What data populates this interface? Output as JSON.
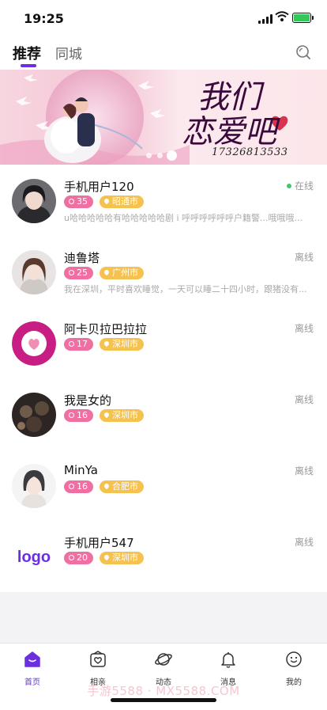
{
  "status_bar": {
    "time": "19:25"
  },
  "header": {
    "tabs": [
      {
        "label": "推荐",
        "active": true
      },
      {
        "label": "同城",
        "active": false
      }
    ]
  },
  "banner": {
    "title_line1": "我们",
    "title_line2": "恋爱吧",
    "phone": "17326813533",
    "slides": 3,
    "active_slide": 3
  },
  "users": [
    {
      "name": "手机用户120",
      "status": "在线",
      "online": true,
      "count": "35",
      "city": "昭通市",
      "bio": "u哈哈哈哈哈有哈哈哈哈哈剧 i 呼呼呼呼呼呼户籍警...哦哦哦..."
    },
    {
      "name": "迪鲁塔",
      "status": "离线",
      "online": false,
      "count": "25",
      "city": "广州市",
      "bio": "我在深圳，平时喜欢睡觉，一天可以睡二十四小时，跟猪没有..."
    },
    {
      "name": "阿卡贝拉巴拉拉",
      "status": "离线",
      "online": false,
      "count": "17",
      "city": "深圳市",
      "bio": ""
    },
    {
      "name": "我是女的",
      "status": "离线",
      "online": false,
      "count": "16",
      "city": "深圳市",
      "bio": ""
    },
    {
      "name": "MinYa",
      "status": "离线",
      "online": false,
      "count": "16",
      "city": "合肥市",
      "bio": ""
    },
    {
      "name": "手机用户547",
      "status": "离线",
      "online": false,
      "count": "20",
      "city": "深圳市",
      "bio": "",
      "avatar_text": "logo"
    }
  ],
  "bottom_nav": [
    {
      "label": "首页",
      "icon": "home-icon",
      "active": true
    },
    {
      "label": "相亲",
      "icon": "heart-frame-icon",
      "active": false
    },
    {
      "label": "动态",
      "icon": "planet-icon",
      "active": false
    },
    {
      "label": "消息",
      "icon": "bell-icon",
      "active": false
    },
    {
      "label": "我的",
      "icon": "smiley-icon",
      "active": false
    }
  ],
  "watermark": "手游5588 · MX5588.COM",
  "colors": {
    "accent": "#6b2fe0",
    "count_badge": "#f06fa3",
    "city_badge": "#f6c24f",
    "online": "#3cc96b"
  }
}
